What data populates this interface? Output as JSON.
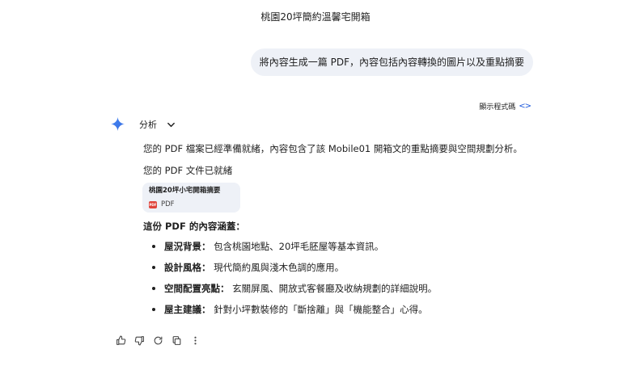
{
  "conversation": {
    "title": "桃園20坪簡約溫馨宅開箱"
  },
  "user_message": "將內容生成一篇 PDF，內容包括內容轉換的圖片以及重點摘要",
  "show_code": {
    "label": "顯示程式碼",
    "icon": "code-icon"
  },
  "analysis": {
    "label": "分析",
    "icon": "chevron-down-icon"
  },
  "response": {
    "paragraph_1": "您的 PDF 檔案已經準備就緒，內容包含了該 Mobile01 開箱文的重點摘要與空間規劃分析。",
    "paragraph_2": "您的 PDF 文件已就緒",
    "file": {
      "name": "桃園20坪小宅開箱摘要",
      "type": "PDF",
      "badge": "PDF"
    },
    "heading": "這份 PDF 的內容涵蓋：",
    "bullets": [
      {
        "label": "屋況背景：",
        "text": " 包含桃園地點、20坪毛胚屋等基本資訊。"
      },
      {
        "label": "設計風格：",
        "text": " 現代簡約風與淺木色調的應用。"
      },
      {
        "label": "空間配置亮點：",
        "text": " 玄關屏風、開放式客餐廳及收納規劃的詳細說明。"
      },
      {
        "label": "屋主建議：",
        "text": " 針對小坪數裝修的「斷捨離」與「機能整合」心得。"
      }
    ]
  },
  "actions": [
    "thumbs-up-icon",
    "thumbs-down-icon",
    "redo-icon",
    "copy-icon",
    "more-vert-icon"
  ],
  "colors": {
    "bubble_bg": "#eef1f7",
    "accent_blue": "#1a56db",
    "pdf_red": "#e0443b"
  }
}
